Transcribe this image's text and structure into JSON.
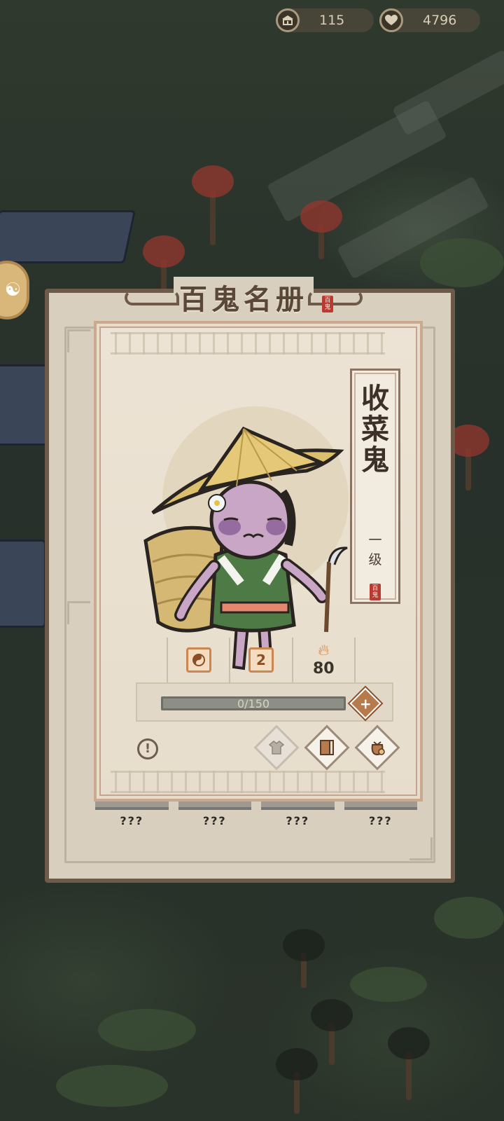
{
  "resources": {
    "buildings": {
      "icon": "temple-icon",
      "value": "115"
    },
    "hearts": {
      "icon": "heart-icon",
      "value": "4796"
    }
  },
  "dialog": {
    "title": "百鬼名册",
    "title_seal": "百鬼",
    "card": {
      "name": "收菜鬼",
      "level": "一级",
      "plaque_seal": "百鬼",
      "stats": [
        {
          "icon": "yin-yang-badge-icon",
          "value": ""
        },
        {
          "icon": "rank-badge-icon",
          "value": "2"
        },
        {
          "icon": "fire-icon",
          "value": "80"
        }
      ],
      "progress": {
        "text": "0/150",
        "current": 0,
        "max": 150
      },
      "actions": [
        {
          "icon": "clothing-icon",
          "enabled": false
        },
        {
          "icon": "book-icon",
          "enabled": true
        },
        {
          "icon": "treasure-bag-icon",
          "enabled": true
        }
      ]
    },
    "hidden_slots": [
      "???",
      "???",
      "???",
      "???"
    ]
  },
  "colors": {
    "frame": "#6e5a49",
    "card_bg": "#ece3d4",
    "accent": "#b77a4d",
    "seal_red": "#b83a30"
  }
}
